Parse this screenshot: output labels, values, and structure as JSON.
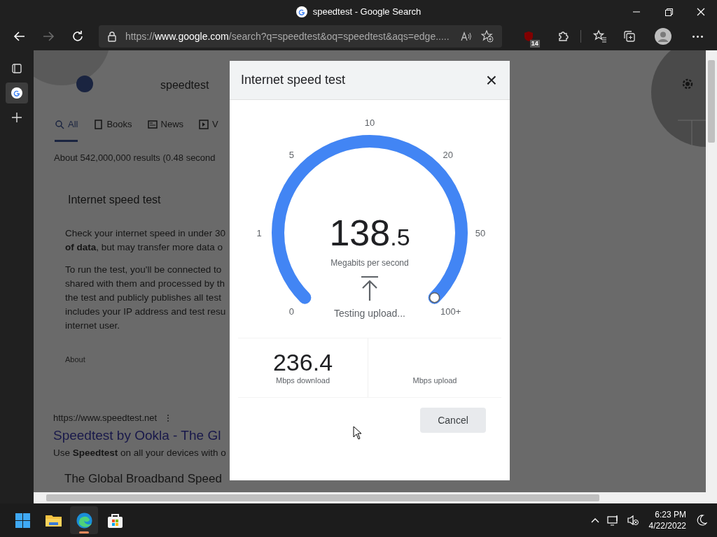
{
  "browser": {
    "title": "speedtest - Google Search",
    "address": {
      "scheme": "https://",
      "host": "www.google.com",
      "path": "/search?q=speedtest&oq=speedtest&aqs=edge....."
    },
    "extension_badge": "14",
    "forward_disabled": true,
    "sidebar_tabs": [
      {
        "kind": "google",
        "selected": true
      }
    ]
  },
  "page": {
    "search_query": "speedtest",
    "tabs": [
      {
        "label": "All",
        "kind": "search",
        "selected": true
      },
      {
        "label": "Books",
        "kind": "book",
        "selected": false
      },
      {
        "label": "News",
        "kind": "news",
        "selected": false
      },
      {
        "label": "V",
        "kind": "video",
        "selected": false
      }
    ],
    "result_stats": "About 542,000,000 results (0.48 second",
    "card_title": "Internet speed test",
    "paragraphs": [
      [
        "Check your internet speed in under 30",
        "**of data**, but may transfer more data o"
      ],
      [
        "To run the test, you'll be connected to",
        "shared with them and processed by th",
        "the test and publicly publishes all test",
        "includes your IP address and test resu",
        "internet user."
      ]
    ],
    "about": "About",
    "results": [
      {
        "url": "https://www.speedtest.net",
        "title": "Speedtest by Ookla - The Gl",
        "snippet": "Use **Speedtest** on all your devices with o"
      },
      {
        "title": "The Global Broadband Speed"
      }
    ]
  },
  "dialog": {
    "title": "Internet speed test",
    "close": "×",
    "gauge": {
      "ticks": [
        "0",
        "1",
        "5",
        "10",
        "20",
        "50",
        "100+"
      ],
      "level": 1,
      "value": "138",
      "decimal": ".5",
      "unit": "Megabits per second",
      "status": "Testing upload..."
    },
    "download": {
      "value": "236.4",
      "label": "Mbps download"
    },
    "upload": {
      "label": "Mbps upload"
    },
    "cancel": "Cancel"
  },
  "taskbar": {
    "apps": [
      {
        "kind": "start",
        "selected": false
      },
      {
        "kind": "files",
        "selected": false
      },
      {
        "kind": "edge",
        "selected": true
      },
      {
        "kind": "store",
        "selected": false
      }
    ],
    "time": "6:23 PM",
    "date": "4/22/2022"
  }
}
